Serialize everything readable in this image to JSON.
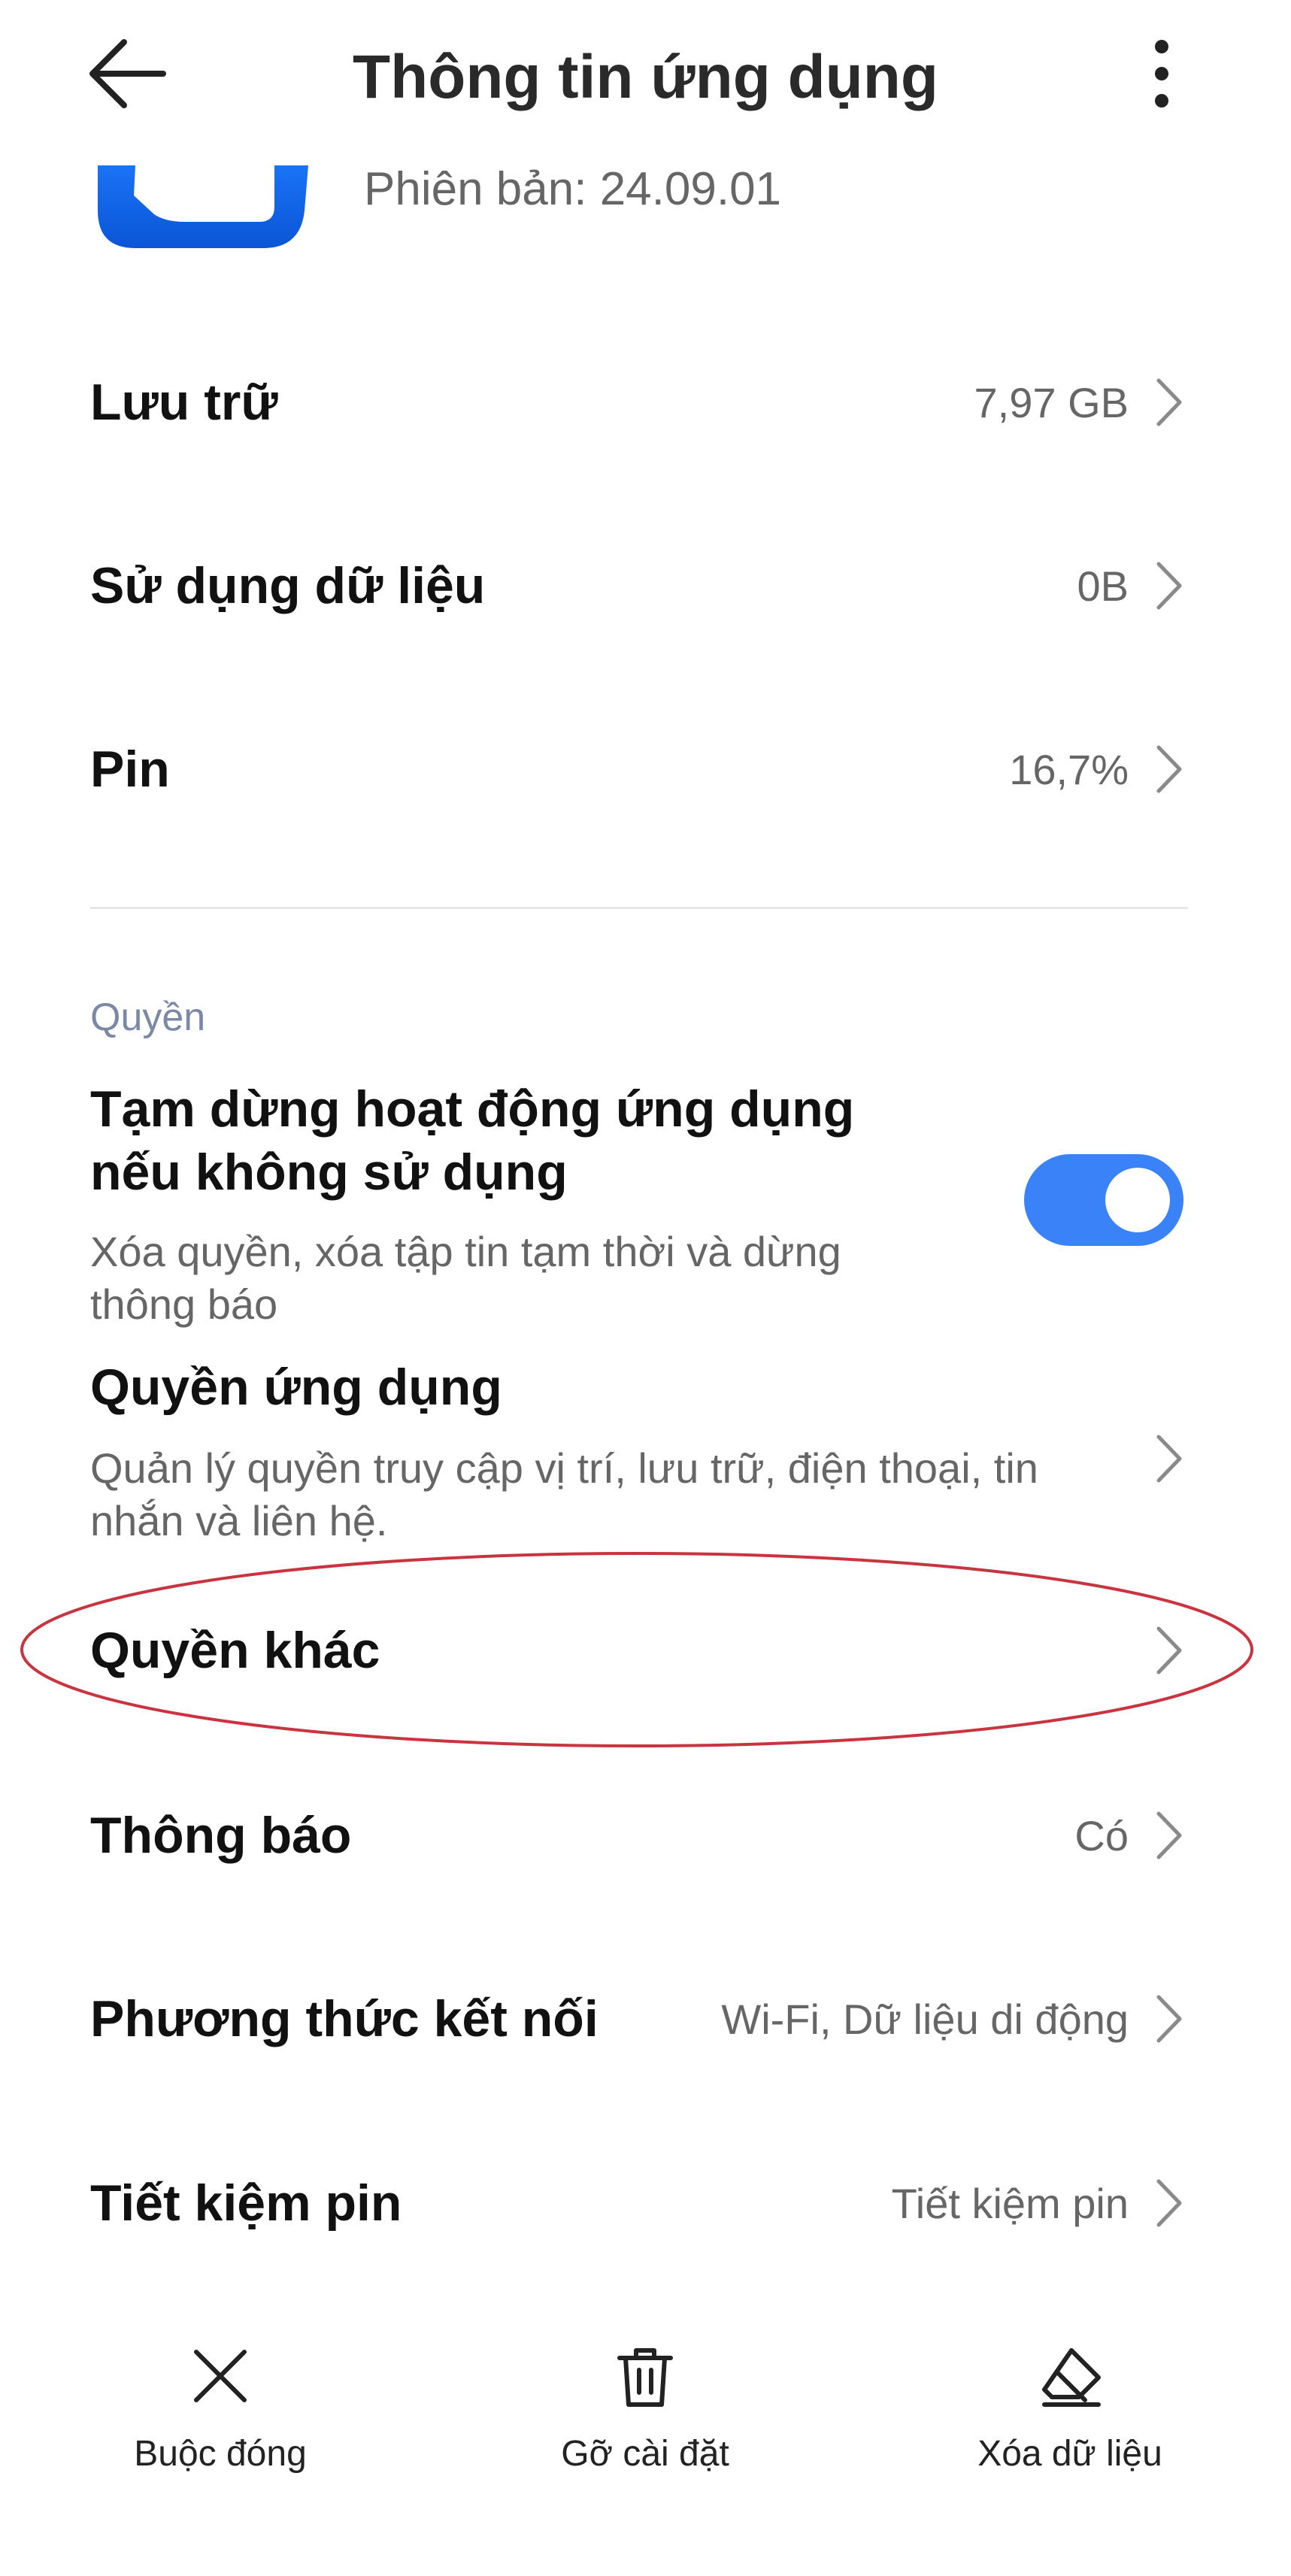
{
  "header": {
    "title": "Thông tin ứng dụng",
    "back_icon": "arrow-left-icon",
    "more_icon": "more-vertical-icon"
  },
  "app": {
    "version": "Phiên bản: 24.09.01",
    "icon": "app-logo-icon",
    "icon_color": "#1565e8"
  },
  "rows": {
    "storage": {
      "title": "Lưu trữ",
      "value": "7,97 GB"
    },
    "data_usage": {
      "title": "Sử dụng dữ liệu",
      "value": "0B"
    },
    "battery": {
      "title": "Pin",
      "value": "16,7%"
    }
  },
  "permissions": {
    "section_label": "Quyền",
    "pause_app": {
      "title_line1": "Tạm dừng hoạt động ứng dụng",
      "title_line2": "nếu không sử dụng",
      "desc_line1": "Xóa quyền, xóa tập tin tạm thời và dừng",
      "desc_line2": "thông báo",
      "enabled": true
    },
    "app_permissions": {
      "title": "Quyền ứng dụng",
      "desc_line1": "Quản lý quyền truy cập vị trí, lưu trữ, điện thoại, tin",
      "desc_line2": "nhắn và liên hệ."
    },
    "other_permissions": {
      "title": "Quyền khác"
    }
  },
  "settings": {
    "notifications": {
      "title": "Thông báo",
      "value": "Có"
    },
    "connection": {
      "title": "Phương thức kết nối",
      "value": "Wi-Fi, Dữ liệu di động"
    },
    "battery_saver": {
      "title": "Tiết kiệm pin",
      "value": "Tiết kiệm pin"
    }
  },
  "bottom_bar": {
    "force_stop": {
      "label": "Buộc đóng",
      "icon": "close-icon"
    },
    "uninstall": {
      "label": "Gỡ cài đặt",
      "icon": "trash-icon"
    },
    "clear_data": {
      "label": "Xóa dữ liệu",
      "icon": "eraser-icon"
    }
  },
  "colors": {
    "accent": "#3a82f7",
    "highlight_ring": "#c8343f"
  }
}
